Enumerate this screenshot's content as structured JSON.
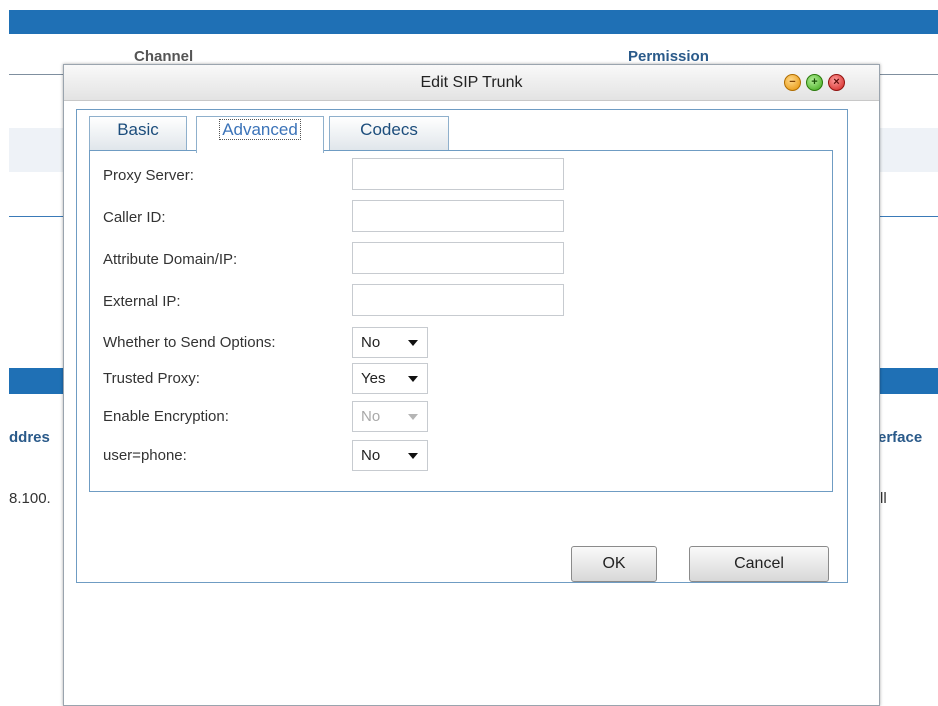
{
  "background": {
    "header_channel": "Channel",
    "header_permission": "Permission",
    "left_fragment": "ddres",
    "right_fragment": "erface",
    "cell_left": "8.100.",
    "cell_right": "ll"
  },
  "dialog": {
    "title": "Edit SIP Trunk",
    "tabs": [
      {
        "label": "Basic",
        "active": false
      },
      {
        "label": "Advanced",
        "active": true
      },
      {
        "label": "Codecs",
        "active": false
      }
    ],
    "fields": {
      "proxy_server": {
        "label": "Proxy Server:",
        "value": ""
      },
      "caller_id": {
        "label": "Caller ID:",
        "value": ""
      },
      "attribute_domain": {
        "label": "Attribute Domain/IP:",
        "value": ""
      },
      "external_ip": {
        "label": "External IP:",
        "value": ""
      },
      "send_options": {
        "label": "Whether to Send Options:",
        "value": "No"
      },
      "trusted_proxy": {
        "label": "Trusted Proxy:",
        "value": "Yes"
      },
      "encryption": {
        "label": "Enable Encryption:",
        "value": "No",
        "disabled": true
      },
      "user_phone": {
        "label": "user=phone:",
        "value": "No"
      }
    },
    "buttons": {
      "ok": "OK",
      "cancel": "Cancel"
    }
  },
  "colors": {
    "accent_bar": "#1f70b5",
    "tab_text": "#1c4d7c",
    "border": "#6f9cc3"
  }
}
